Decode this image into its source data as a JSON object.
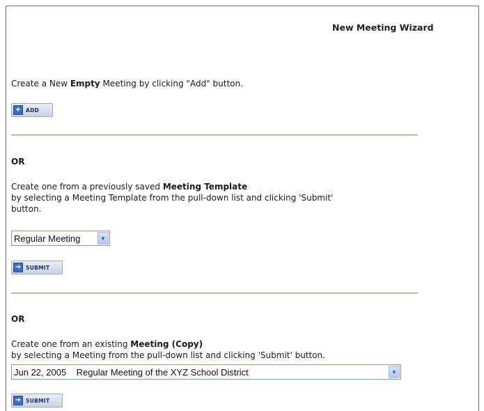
{
  "wizard": {
    "title": "New Meeting Wizard"
  },
  "empty_section": {
    "text_pre": "Create a New ",
    "text_bold": "Empty",
    "text_post": " Meeting by clicking \"Add\" button.",
    "button_label": "ADD"
  },
  "template_section": {
    "or_label": "OR",
    "line1_pre": "Create one from a previously saved ",
    "line1_bold": "Meeting Template",
    "line2": "by selecting a Meeting Template from the pull-down list and clicking 'Submit'",
    "line3": "button.",
    "select_value": "Regular Meeting",
    "button_label": "SUBMIT"
  },
  "copy_section": {
    "or_label": "OR",
    "line1_pre": "Create one from an existing ",
    "line1_bold": "Meeting (Copy)",
    "line2": "by selecting a Meeting from the pull-down list and clicking 'Submit' button.",
    "select_value": "Jun 22, 2005    Regular Meeting of the XYZ School District",
    "button_label": "SUBMIT"
  },
  "icons": {
    "add": "plus-icon",
    "submit": "submit-arrow-icon",
    "dropdown": "chevron-down-icon"
  }
}
